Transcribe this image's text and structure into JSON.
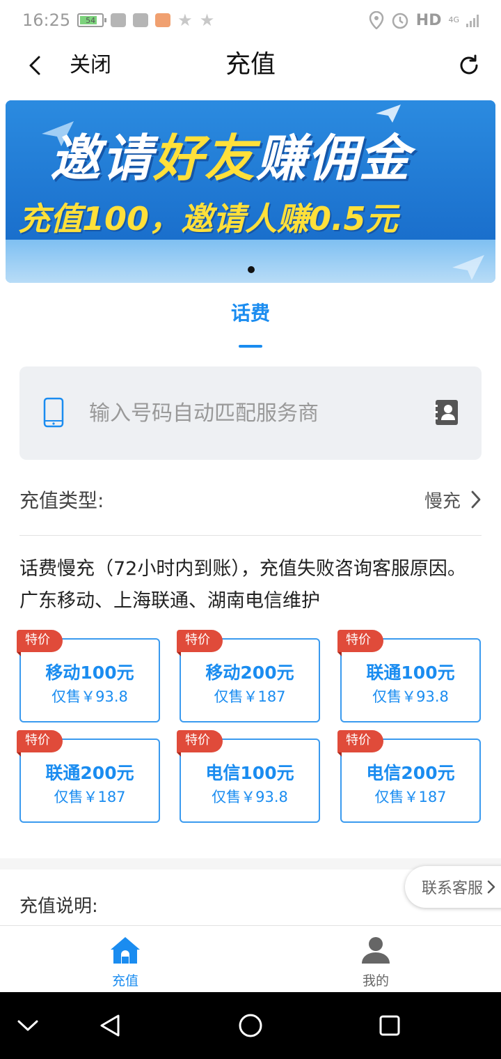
{
  "status_bar": {
    "time": "16:25",
    "battery": "54",
    "network": "HD",
    "network_sub": "4G"
  },
  "header": {
    "close_label": "关闭",
    "title": "充值"
  },
  "banner": {
    "line1_part1": "邀请",
    "line1_highlight": "好友",
    "line1_part2": "赚佣金",
    "line2": "充值100，邀请人赚0.5元"
  },
  "tabs": [
    {
      "label": "话费",
      "active": true
    }
  ],
  "phone_input": {
    "placeholder": "输入号码自动匹配服务商",
    "value": ""
  },
  "recharge_type": {
    "label": "充值类型:",
    "value": "慢充"
  },
  "notice": "话费慢充（72小时内到账），充值失败咨询客服原因。广东移动、上海联通、湖南电信维护",
  "products": [
    {
      "badge": "特价",
      "name": "移动100元",
      "price": "仅售￥93.8"
    },
    {
      "badge": "特价",
      "name": "移动200元",
      "price": "仅售￥187"
    },
    {
      "badge": "特价",
      "name": "联通100元",
      "price": "仅售￥93.8"
    },
    {
      "badge": "特价",
      "name": "联通200元",
      "price": "仅售￥187"
    },
    {
      "badge": "特价",
      "name": "电信100元",
      "price": "仅售￥93.8"
    },
    {
      "badge": "特价",
      "name": "电信200元",
      "price": "仅售￥187"
    }
  ],
  "explain_title": "充值说明:",
  "contact_button": "联系客服",
  "bottom_nav": [
    {
      "label": "充值",
      "icon": "home-icon",
      "active": true
    },
    {
      "label": "我的",
      "icon": "user-icon",
      "active": false
    }
  ],
  "colors": {
    "accent": "#1a8cf0",
    "badge": "#e04b3a",
    "input_bg": "#eef0f3"
  }
}
